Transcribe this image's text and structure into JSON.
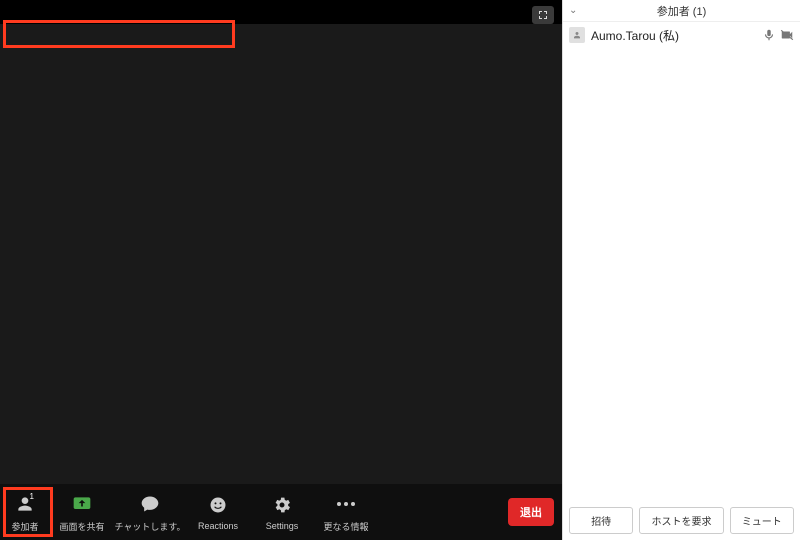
{
  "panel": {
    "title": "参加者 (1)",
    "participants": [
      {
        "name": "Aumo.Tarou (私)"
      }
    ],
    "footer": {
      "invite": "招待",
      "claim_host": "ホストを要求",
      "mute": "ミュート"
    }
  },
  "toolbar": {
    "participants": {
      "label": "参加者",
      "count": "1"
    },
    "share": {
      "label": "画面を共有"
    },
    "chat": {
      "label": "チャットします。"
    },
    "reactions": {
      "label": "Reactions"
    },
    "settings": {
      "label": "Settings"
    },
    "more": {
      "label": "更なる情報"
    },
    "leave": {
      "label": "退出"
    }
  }
}
